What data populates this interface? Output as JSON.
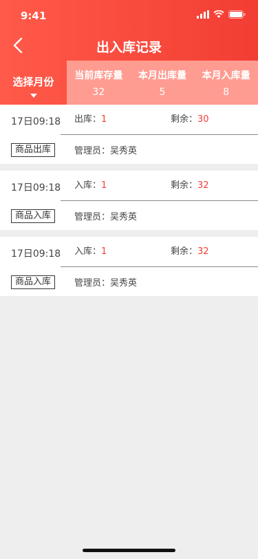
{
  "status_bar": {
    "time": "9:41"
  },
  "nav": {
    "title": "出入库记录"
  },
  "filter": {
    "month_label": "选择月份"
  },
  "stats": [
    {
      "label": "当前库存量",
      "value": "32"
    },
    {
      "label": "本月出库量",
      "value": "5"
    },
    {
      "label": "本月入库量",
      "value": "8"
    }
  ],
  "records": [
    {
      "date": "17日09:18",
      "tag": "商品出库",
      "qty_label": "出库：",
      "qty": "1",
      "remain_label": "剩余：",
      "remain": "30",
      "manager_label": "管理员：",
      "manager": "吴秀英"
    },
    {
      "date": "17日09:18",
      "tag": "商品入库",
      "qty_label": "入库：",
      "qty": "1",
      "remain_label": "剩余：",
      "remain": "32",
      "manager_label": "管理员：",
      "manager": "吴秀英"
    },
    {
      "date": "17日09:18",
      "tag": "商品入库",
      "qty_label": "入库：",
      "qty": "1",
      "remain_label": "剩余：",
      "remain": "32",
      "manager_label": "管理员：",
      "manager": "吴秀英"
    }
  ],
  "colors": {
    "accent": "#f23d33",
    "stats_bg": "#ff9c91"
  },
  "icons": {
    "back": "chevron-left-icon",
    "signal": "signal-icon",
    "wifi": "wifi-icon",
    "battery": "battery-icon"
  }
}
